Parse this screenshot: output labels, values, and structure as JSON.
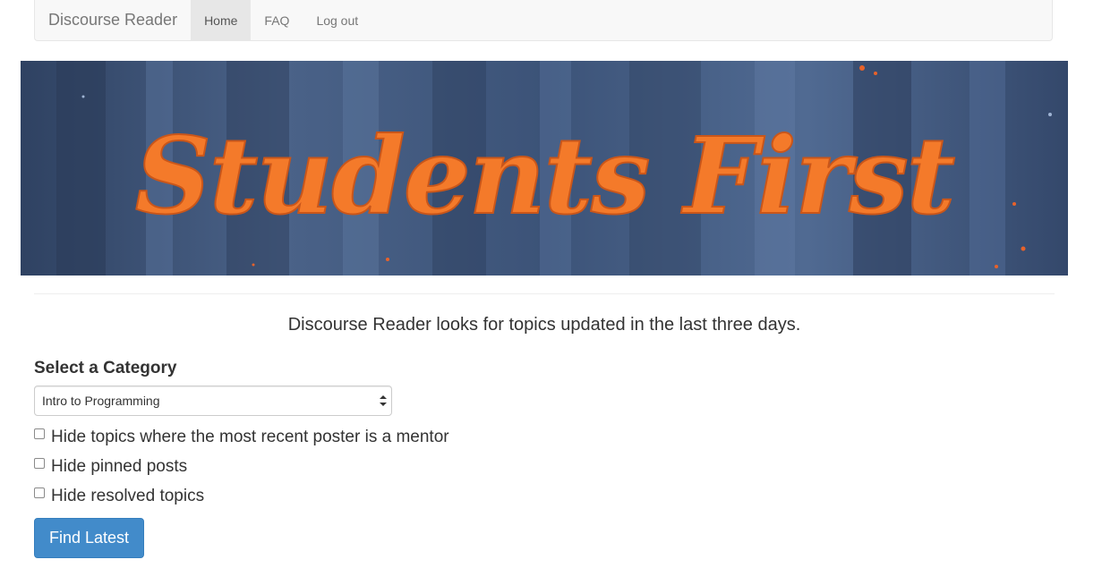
{
  "navbar": {
    "brand": "Discourse Reader",
    "links": [
      {
        "label": "Home",
        "active": true
      },
      {
        "label": "FAQ",
        "active": false
      },
      {
        "label": "Log out",
        "active": false
      }
    ]
  },
  "banner": {
    "text": "Students First",
    "text_color": "#f47a2a",
    "background_color": "#3e5475"
  },
  "intro_text": "Discourse Reader looks for topics updated in the last three days.",
  "form": {
    "category_label": "Select a Category",
    "category_selected": "Intro to Programming",
    "checkboxes": [
      {
        "label": "Hide topics where the most recent poster is a mentor",
        "checked": false
      },
      {
        "label": "Hide pinned posts",
        "checked": false
      },
      {
        "label": "Hide resolved topics",
        "checked": false
      }
    ],
    "submit_label": "Find Latest"
  },
  "colors": {
    "primary_button": "#428bca",
    "navbar_bg": "#f8f8f8",
    "active_tab_bg": "#e7e7e7"
  }
}
